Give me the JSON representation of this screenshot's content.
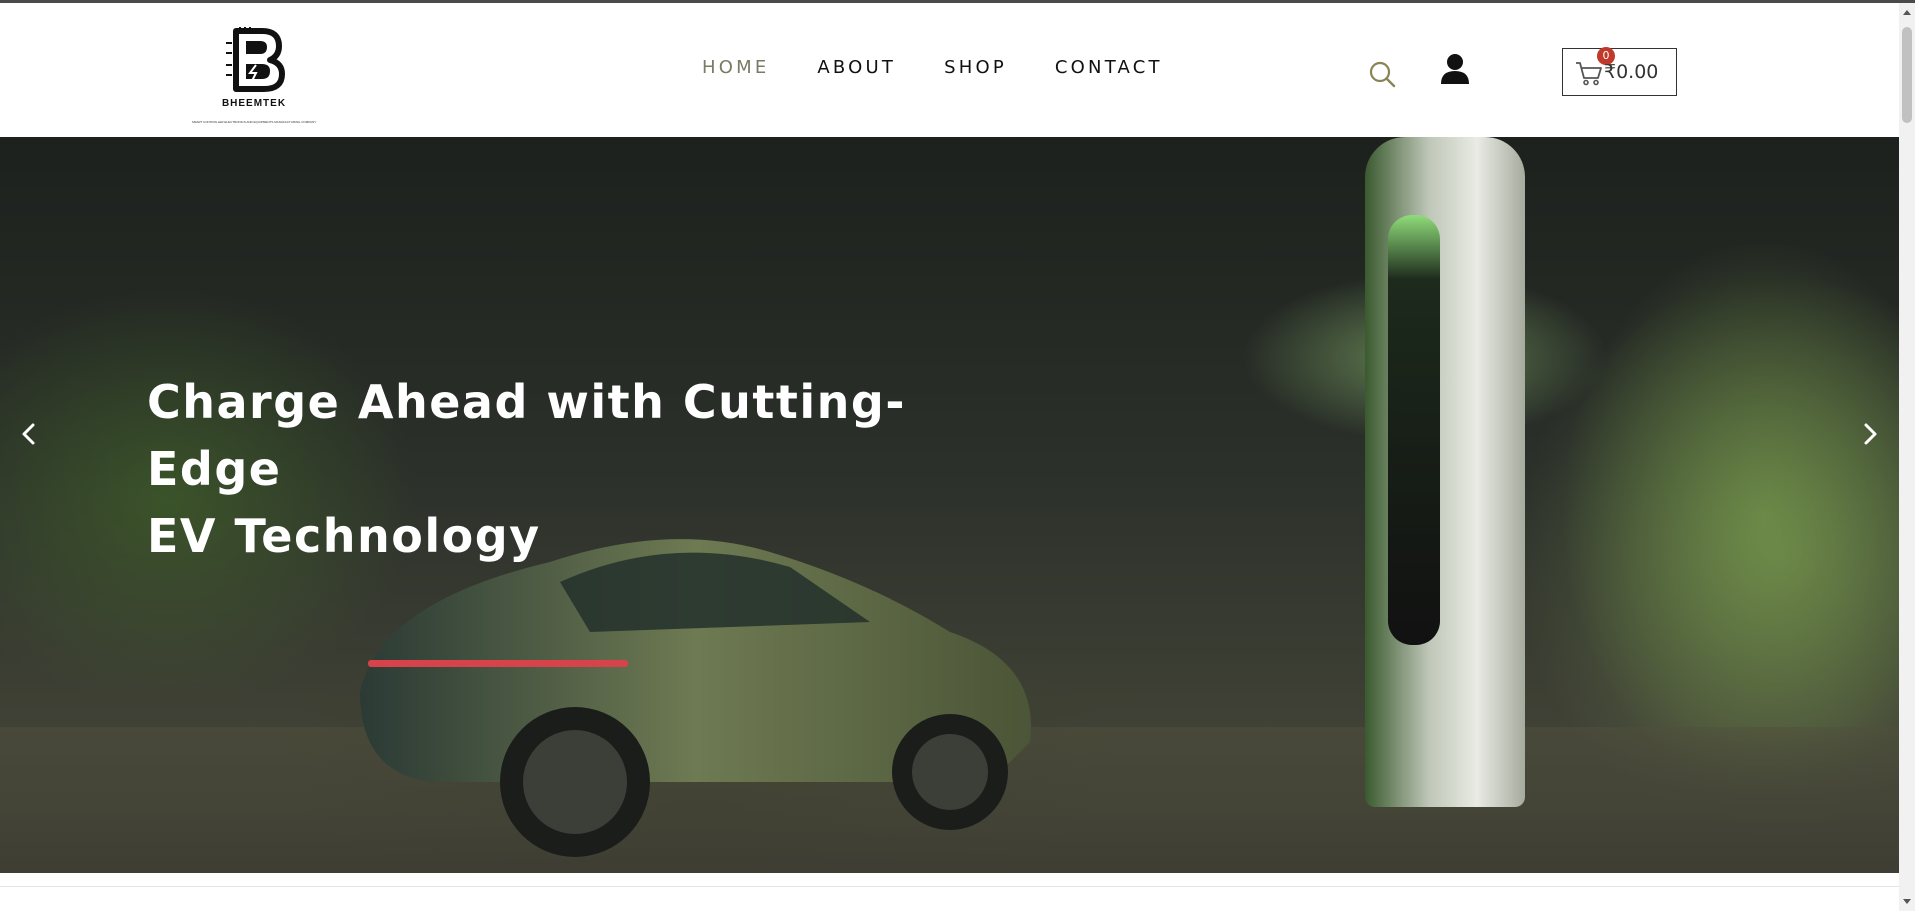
{
  "header": {
    "logo": {
      "name": "BHEEMTEK",
      "tagline": "SMART CONTROLLER ELECTRONICS AND EQUIPMENTS MANUFACTURING COMPANY"
    },
    "nav": [
      {
        "label": "HOME",
        "active": true
      },
      {
        "label": "ABOUT",
        "active": false
      },
      {
        "label": "SHOP",
        "active": false
      },
      {
        "label": "CONTACT",
        "active": false
      }
    ],
    "icons": {
      "search": "search-icon",
      "account": "user-icon",
      "cart": "cart-icon"
    },
    "cart": {
      "count": "0",
      "total": "₹0.00"
    }
  },
  "hero": {
    "title_line1": "Charge Ahead with Cutting-Edge",
    "title_line2": "EV Technology",
    "prev_icon": "chevron-left-icon",
    "next_icon": "chevron-right-icon"
  },
  "colors": {
    "nav_active": "#7a7a66",
    "search_icon": "#8a8455",
    "cart_badge": "#c0392b",
    "text": "#111111"
  }
}
